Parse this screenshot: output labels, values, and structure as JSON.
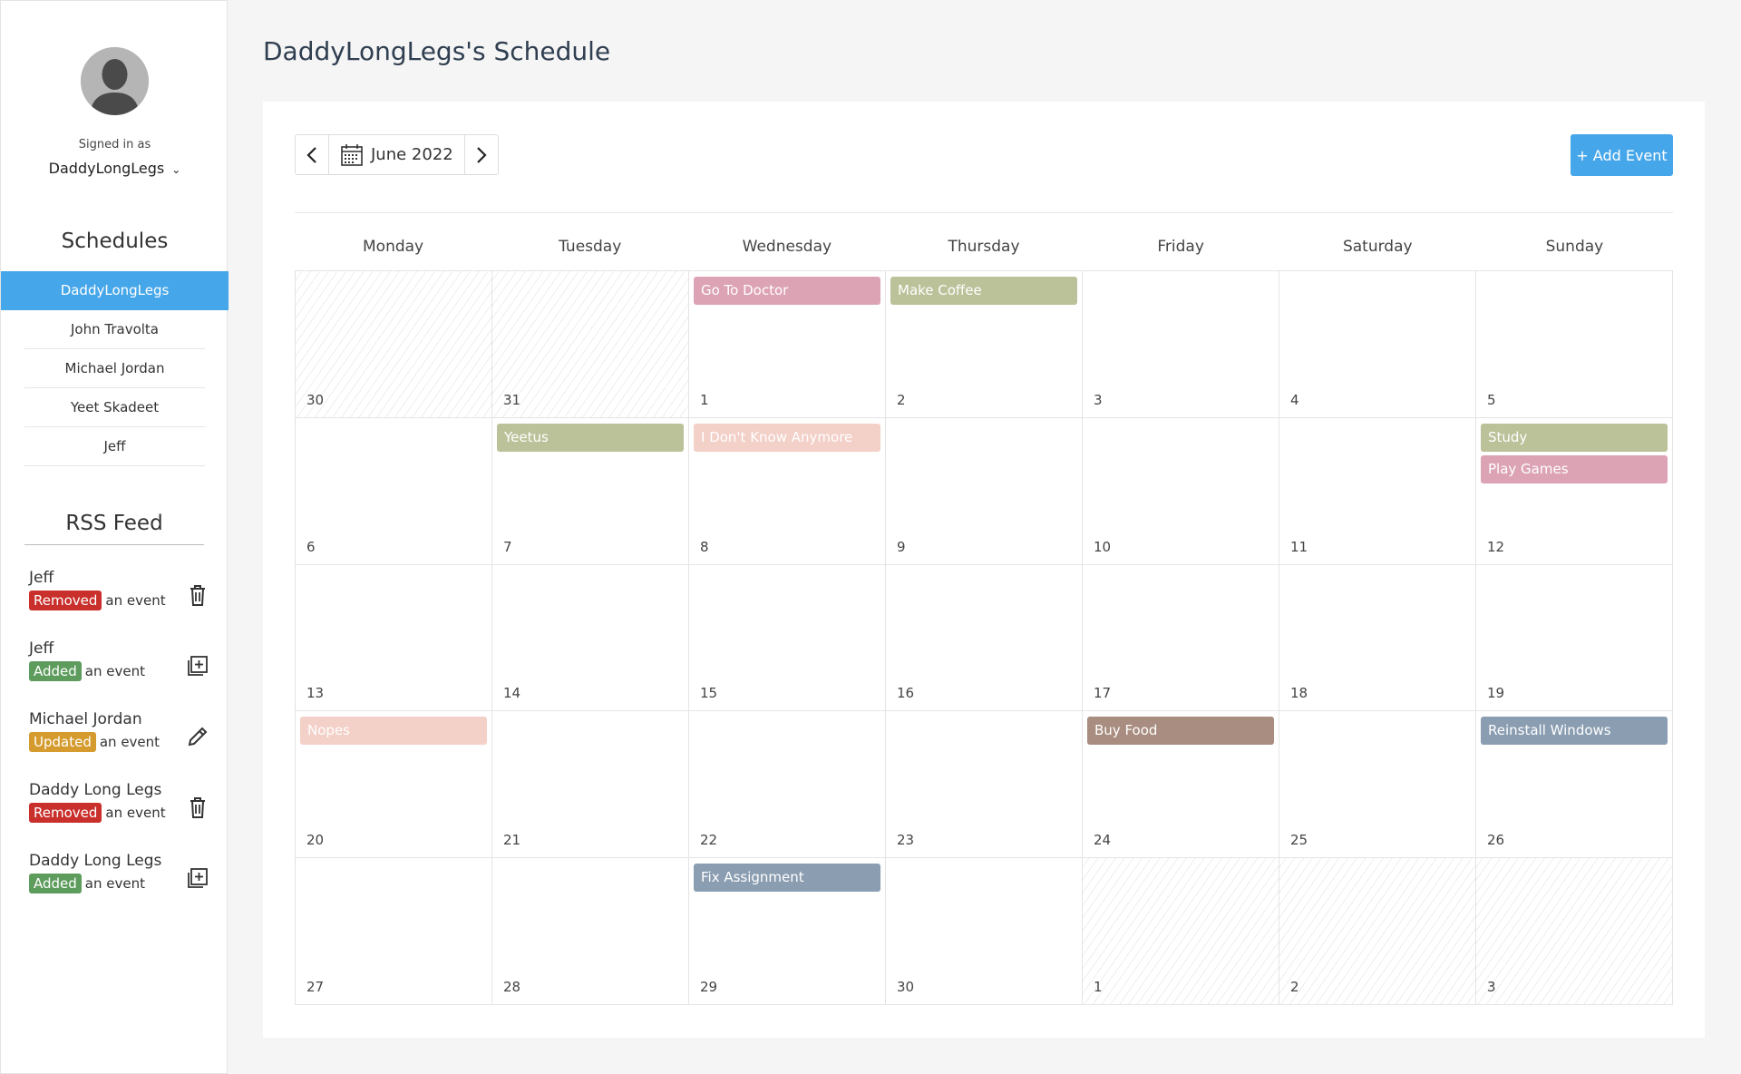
{
  "sidebar": {
    "signed_in_label": "Signed in as",
    "username": "DaddyLongLegs",
    "schedules_title": "Schedules",
    "schedules": [
      {
        "label": "DaddyLongLegs",
        "active": true
      },
      {
        "label": "John Travolta",
        "active": false
      },
      {
        "label": "Michael Jordan",
        "active": false
      },
      {
        "label": "Yeet Skadeet",
        "active": false
      },
      {
        "label": "Jeff",
        "active": false
      }
    ],
    "rss_title": "RSS Feed",
    "rss": [
      {
        "user": "Jeff",
        "action": "Removed",
        "kind": "removed",
        "suffix": "an event",
        "icon": "trash-icon"
      },
      {
        "user": "Jeff",
        "action": "Added",
        "kind": "added",
        "suffix": "an event",
        "icon": "add-box-icon"
      },
      {
        "user": "Michael Jordan",
        "action": "Updated",
        "kind": "updated",
        "suffix": "an event",
        "icon": "pencil-icon"
      },
      {
        "user": "Daddy Long Legs",
        "action": "Removed",
        "kind": "removed",
        "suffix": "an event",
        "icon": "trash-icon"
      },
      {
        "user": "Daddy Long Legs",
        "action": "Added",
        "kind": "added",
        "suffix": "an event",
        "icon": "add-box-icon"
      }
    ]
  },
  "main": {
    "title": "DaddyLongLegs's Schedule",
    "month_label": "June 2022",
    "add_event_label": "+ Add Event",
    "weekdays": [
      "Monday",
      "Tuesday",
      "Wednesday",
      "Thursday",
      "Friday",
      "Saturday",
      "Sunday"
    ],
    "days": [
      {
        "num": "30",
        "other": true,
        "events": []
      },
      {
        "num": "31",
        "other": true,
        "events": []
      },
      {
        "num": "1",
        "other": false,
        "events": [
          {
            "title": "Go To Doctor",
            "color": "#dca3b5"
          }
        ]
      },
      {
        "num": "2",
        "other": false,
        "events": [
          {
            "title": "Make Coffee",
            "color": "#bbc299"
          }
        ]
      },
      {
        "num": "3",
        "other": false,
        "events": []
      },
      {
        "num": "4",
        "other": false,
        "events": []
      },
      {
        "num": "5",
        "other": false,
        "events": []
      },
      {
        "num": "6",
        "other": false,
        "events": []
      },
      {
        "num": "7",
        "other": false,
        "events": [
          {
            "title": "Yeetus",
            "color": "#bbc299"
          }
        ]
      },
      {
        "num": "8",
        "other": false,
        "events": [
          {
            "title": "I Don't Know Anymore",
            "color": "#f3d0c8"
          }
        ]
      },
      {
        "num": "9",
        "other": false,
        "events": []
      },
      {
        "num": "10",
        "other": false,
        "events": []
      },
      {
        "num": "11",
        "other": false,
        "events": []
      },
      {
        "num": "12",
        "other": false,
        "events": [
          {
            "title": "Study",
            "color": "#bbc299"
          },
          {
            "title": "Play Games",
            "color": "#dca3b5"
          }
        ]
      },
      {
        "num": "13",
        "other": false,
        "events": []
      },
      {
        "num": "14",
        "other": false,
        "events": []
      },
      {
        "num": "15",
        "other": false,
        "events": []
      },
      {
        "num": "16",
        "other": false,
        "events": []
      },
      {
        "num": "17",
        "other": false,
        "events": []
      },
      {
        "num": "18",
        "other": false,
        "events": []
      },
      {
        "num": "19",
        "other": false,
        "events": []
      },
      {
        "num": "20",
        "other": false,
        "events": [
          {
            "title": "Nopes",
            "color": "#f3d0c8"
          }
        ]
      },
      {
        "num": "21",
        "other": false,
        "events": []
      },
      {
        "num": "22",
        "other": false,
        "events": []
      },
      {
        "num": "23",
        "other": false,
        "events": []
      },
      {
        "num": "24",
        "other": false,
        "events": [
          {
            "title": "Buy Food",
            "color": "#a88d80"
          }
        ]
      },
      {
        "num": "25",
        "other": false,
        "events": []
      },
      {
        "num": "26",
        "other": false,
        "events": [
          {
            "title": "Reinstall Windows",
            "color": "#8a9db1"
          }
        ]
      },
      {
        "num": "27",
        "other": false,
        "events": []
      },
      {
        "num": "28",
        "other": false,
        "events": []
      },
      {
        "num": "29",
        "other": false,
        "events": [
          {
            "title": "Fix Assignment",
            "color": "#8a9db1"
          }
        ]
      },
      {
        "num": "30",
        "other": false,
        "events": []
      },
      {
        "num": "1",
        "other": true,
        "events": []
      },
      {
        "num": "2",
        "other": true,
        "events": []
      },
      {
        "num": "3",
        "other": true,
        "events": []
      }
    ]
  }
}
